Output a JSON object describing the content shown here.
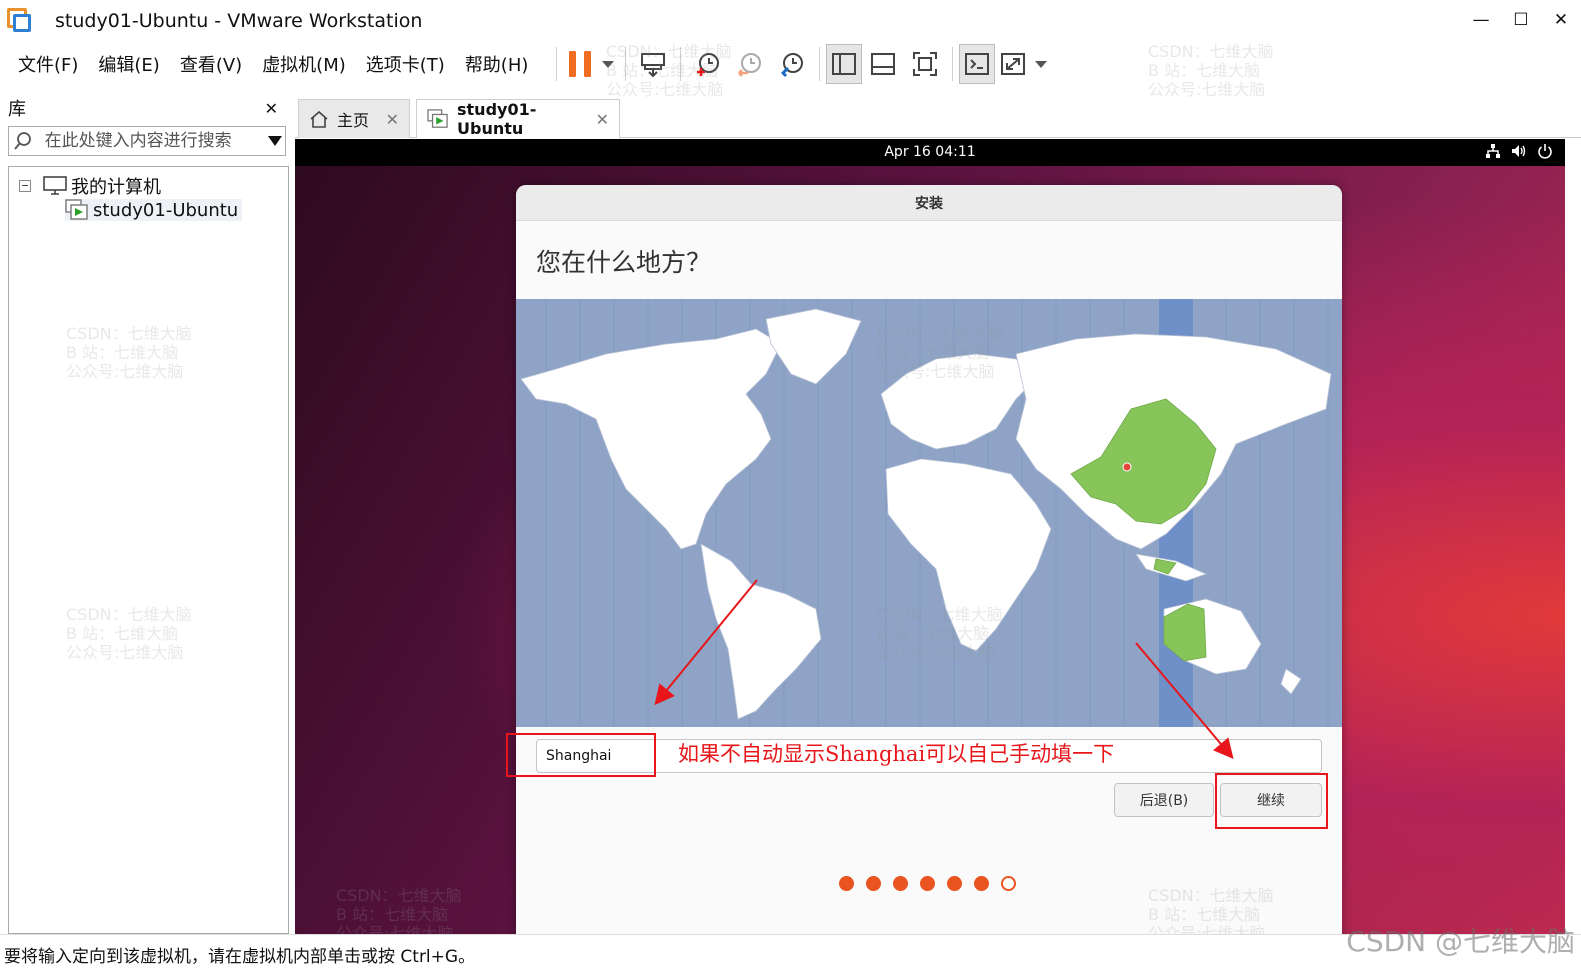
{
  "window": {
    "title": "study01-Ubuntu - VMware Workstation",
    "minimize_glyph": "—",
    "maximize_glyph": "☐",
    "close_glyph": "✕"
  },
  "menu": [
    "文件(F)",
    "编辑(E)",
    "查看(V)",
    "虚拟机(M)",
    "选项卡(T)",
    "帮助(H)"
  ],
  "toolbar_icons": [
    "pause-icon",
    "send-ctrl-alt-del-icon",
    "snapshot-icon",
    "revert-snapshot-icon",
    "snapshot-manager-icon",
    "show-library-icon",
    "thumbnail-bar-icon",
    "full-screen-icon",
    "console-view-icon",
    "stretch-guest-icon"
  ],
  "library": {
    "title": "库",
    "close_glyph": "✕",
    "search_placeholder": "在此处键入内容进行搜索",
    "tree": {
      "root": "我的计算机",
      "root_toggle": "−",
      "vm": "study01-Ubuntu"
    }
  },
  "tabs": [
    {
      "label": "主页",
      "close": "✕"
    },
    {
      "label": "study01-Ubuntu",
      "close": "✕"
    }
  ],
  "guest": {
    "clock": "Apr 16  04:11",
    "installer": {
      "header": "安装",
      "question": "您在什么地方？",
      "timezone_value": "Shanghai",
      "back_label": "后退(B)",
      "next_label": "继续",
      "progress_total": 7,
      "progress_done": 6
    }
  },
  "annotation": {
    "text": "如果不自动显示Shanghai可以自己手动填一下",
    "color": "#e8161a"
  },
  "statusbar": {
    "text": "要将输入定向到该虚拟机，请在虚拟机内部单击或按 Ctrl+G。"
  },
  "credit": "CSDN @七维大脑",
  "watermark": "CSDN：七维大脑\nB 站：七维大脑\n公众号:七维大脑",
  "colors": {
    "ubuntu_orange": "#e95420",
    "map_ocean": "#8ea3c6",
    "map_land": "#ffffff",
    "map_selected_country": "#87c55a",
    "map_timezone_band": "#6f8fc8",
    "vmware_pause": "#ef6c23",
    "annotation_red": "#e8161a"
  }
}
